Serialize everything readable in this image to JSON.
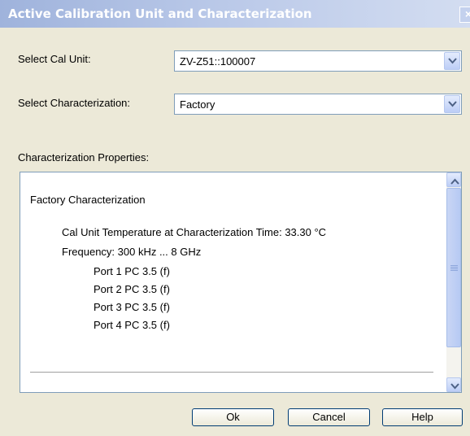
{
  "window": {
    "title": "Active Calibration Unit and Characterization",
    "close_glyph": "×"
  },
  "cal_unit": {
    "label": "Select Cal Unit:",
    "value": "ZV-Z51::100007"
  },
  "characterization": {
    "label": "Select Characterization:",
    "value": "Factory"
  },
  "properties": {
    "label": "Characterization Properties:",
    "heading": "Factory Characterization",
    "temperature": "Cal Unit Temperature at Characterization Time: 33.30 °C",
    "frequency": "Frequency: 300 kHz ... 8 GHz",
    "ports": [
      "Port 1 PC 3.5 (f)",
      "Port 2 PC 3.5 (f)",
      "Port 3 PC 3.5 (f)",
      "Port 4 PC 3.5 (f)"
    ]
  },
  "buttons": {
    "ok": "Ok",
    "cancel": "Cancel",
    "help": "Help"
  },
  "icons": {
    "combo_arrow": "chevron-down-icon",
    "scroll_up": "chevron-up-icon",
    "scroll_down": "chevron-down-icon",
    "close": "close-icon"
  },
  "colors": {
    "title_bar": "#9fb3dc",
    "dialog_bg": "#ece9d8",
    "field_border": "#7f9db9",
    "button_border": "#003c74"
  }
}
